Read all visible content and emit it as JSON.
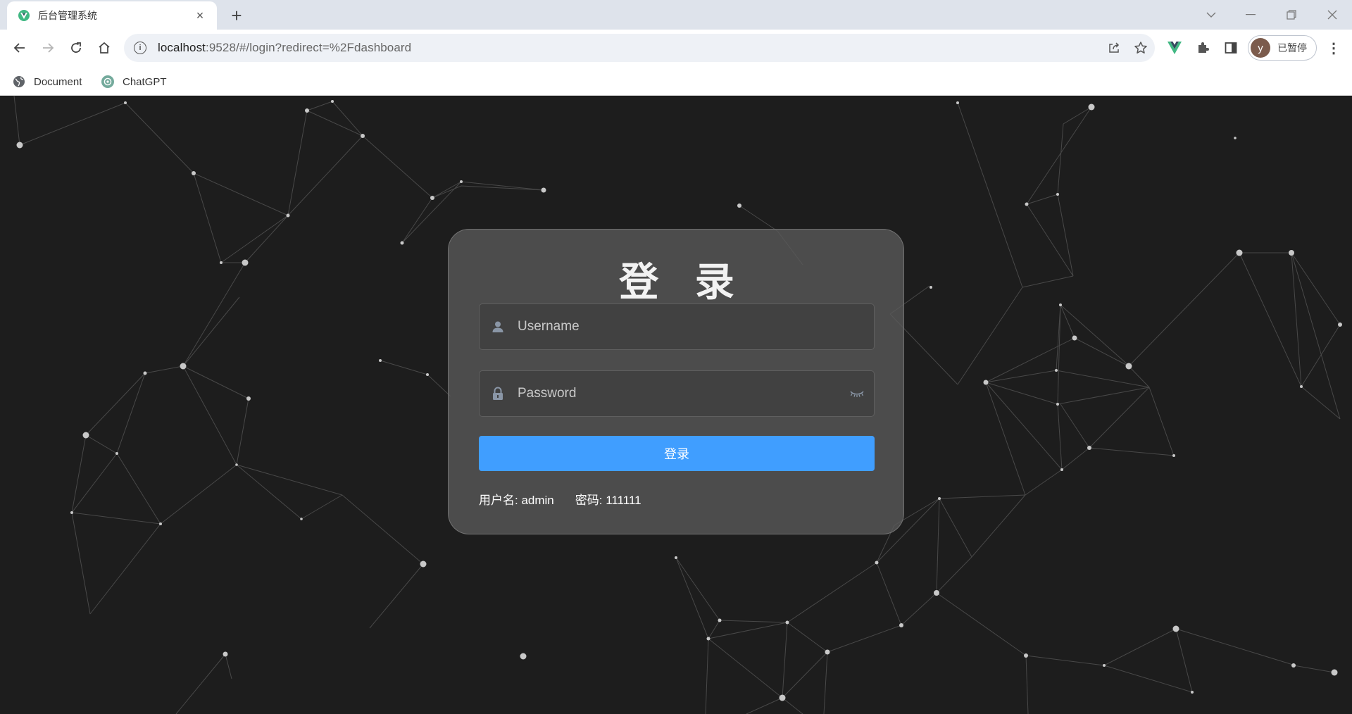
{
  "browser": {
    "tab_title": "后台管理系统",
    "tab_close": "×",
    "new_tab": "+",
    "url_host": "localhost",
    "url_rest": ":9528/#/login?redirect=%2Fdashboard",
    "profile_initial": "y",
    "profile_status": "已暂停",
    "bookmarks": [
      {
        "label": "Document"
      },
      {
        "label": "ChatGPT"
      }
    ]
  },
  "login": {
    "title": "登 录",
    "username_placeholder": "Username",
    "password_placeholder": "Password",
    "submit_label": "登录",
    "tip_username": "用户名: admin",
    "tip_password": "密码: 111111"
  },
  "colors": {
    "page_background": "#1d1d1d",
    "card_background": "#5a5a5a",
    "primary_button": "#409eff",
    "vue_green": "#41b883"
  }
}
